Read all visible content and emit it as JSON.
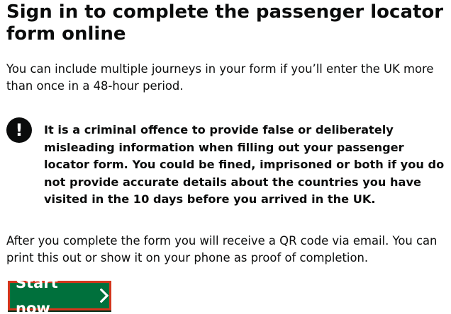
{
  "page": {
    "title": "Sign in to complete the passenger locator form online",
    "intro": "You can include multiple journeys in your form if you’ll enter the UK more than once in a 48-hour period.",
    "warning": {
      "icon": "exclamation-icon",
      "symbol": "!",
      "text": "It is a criminal offence to provide false or deliberately misleading information when filling out your passenger locator form. You could be fined, imprisoned or both if you do not provide accurate details about the countries you have visited in the 10 days before you arrived in the UK."
    },
    "after": "After you complete the form you will receive a QR code via email. You can print this out or show it on your phone as proof of completion.",
    "start_button": {
      "label": "Start now",
      "icon": "chevron-right-icon"
    }
  },
  "colors": {
    "text": "#0b0c0c",
    "button_green": "#00703c",
    "focus_border": "#d4351c",
    "background": "#ffffff"
  }
}
